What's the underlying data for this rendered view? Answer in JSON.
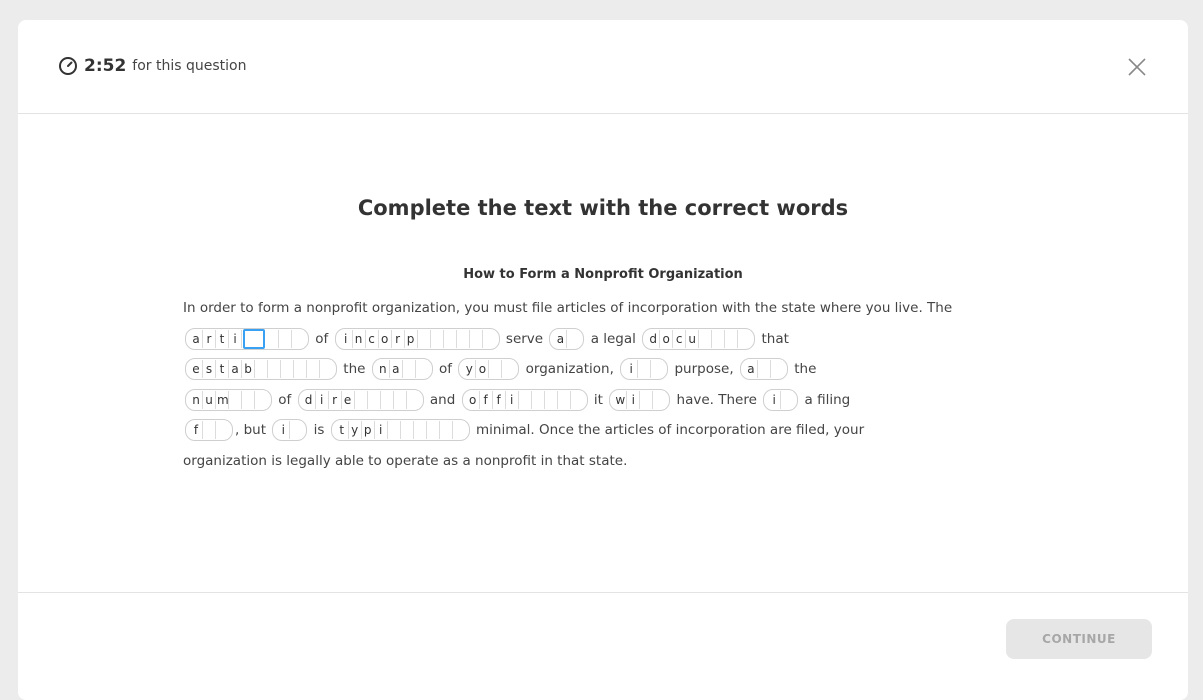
{
  "timer": {
    "time": "2:52",
    "label": "for this question"
  },
  "title": "Complete the text with the correct words",
  "subtitle": "How to Form a Nonprofit Organization",
  "intro": "In order to form a nonprofit organization, you must file articles of incorporation with the state where you live. The",
  "passage": [
    {
      "blank": [
        "a",
        "r",
        "t",
        "i",
        "",
        "",
        "",
        ""
      ],
      "active": 4
    },
    {
      "text": "of"
    },
    {
      "blank": [
        "i",
        "n",
        "c",
        "o",
        "r",
        "p",
        "",
        "",
        "",
        "",
        "",
        ""
      ]
    },
    {
      "text": "serve"
    },
    {
      "blank": [
        "a",
        ""
      ]
    },
    {
      "text": "a legal"
    },
    {
      "blank": [
        "d",
        "o",
        "c",
        "u",
        "",
        "",
        "",
        ""
      ]
    },
    {
      "text": "that"
    },
    {
      "br": true
    },
    {
      "blank": [
        "e",
        "s",
        "t",
        "a",
        "b",
        "",
        "",
        "",
        "",
        "",
        ""
      ]
    },
    {
      "text": "the"
    },
    {
      "blank": [
        "n",
        "a",
        "",
        ""
      ]
    },
    {
      "text": "of"
    },
    {
      "blank": [
        "y",
        "o",
        "",
        ""
      ]
    },
    {
      "text": "organization,"
    },
    {
      "blank": [
        "i",
        "",
        ""
      ]
    },
    {
      "text": "purpose,"
    },
    {
      "blank": [
        "a",
        "",
        ""
      ]
    },
    {
      "text": "the"
    },
    {
      "br": true
    },
    {
      "blank": [
        "n",
        "u",
        "m",
        "",
        "",
        ""
      ]
    },
    {
      "text": "of"
    },
    {
      "blank": [
        "d",
        "i",
        "r",
        "e",
        "",
        "",
        "",
        "",
        ""
      ]
    },
    {
      "text": "and"
    },
    {
      "blank": [
        "o",
        "f",
        "f",
        "i",
        "",
        "",
        "",
        "",
        ""
      ]
    },
    {
      "text": "it"
    },
    {
      "blank": [
        "w",
        "i",
        "",
        ""
      ]
    },
    {
      "text": "have. There"
    },
    {
      "blank": [
        "i",
        ""
      ]
    },
    {
      "text": "a filing"
    },
    {
      "br": true
    },
    {
      "blank": [
        "f",
        "",
        ""
      ]
    },
    {
      "text": ", but"
    },
    {
      "blank": [
        "i",
        ""
      ]
    },
    {
      "text": "is"
    },
    {
      "blank": [
        "t",
        "y",
        "p",
        "i",
        "",
        "",
        "",
        "",
        "",
        ""
      ]
    },
    {
      "text": "minimal. Once the articles of incorporation are filed, your"
    },
    {
      "br": true
    },
    {
      "text": "organization is legally able to operate as a nonprofit in that state."
    }
  ],
  "continue_label": "CONTINUE",
  "colors": {
    "accent": "#3aa0f2",
    "button_bg": "#e6e6e6",
    "button_text": "#a7a7a7"
  }
}
